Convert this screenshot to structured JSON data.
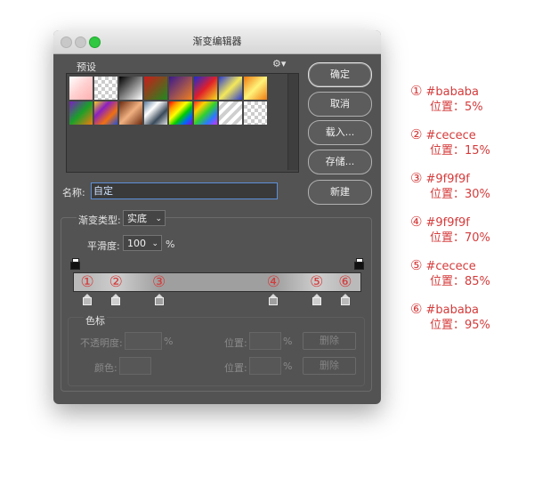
{
  "window": {
    "title": "渐变编辑器"
  },
  "presets": {
    "label": "预设",
    "gear": "gear-icon",
    "swatches_row1": [
      "fg-bg",
      "fg-transparent",
      "black-white",
      "red-green",
      "violet-orange",
      "blue-red-yellow",
      "blue-yellow-blue",
      "orange-yellow-orange"
    ],
    "swatches_row2": [
      "violet-green-orange",
      "yellow-violet-orange-blue",
      "copper",
      "chrome",
      "spectrum",
      "transparent-rainbow",
      "transparent-stripes",
      "transparent"
    ]
  },
  "buttons": {
    "ok": "确定",
    "cancel": "取消",
    "load": "载入...",
    "save": "存储...",
    "new": "新建"
  },
  "name": {
    "label": "名称:",
    "value": "自定"
  },
  "gradient_type": {
    "label": "渐变类型:",
    "value": "实底"
  },
  "smoothness": {
    "label": "平滑度:",
    "value": "100",
    "unit": "%"
  },
  "stops": {
    "numbers": [
      "①",
      "②",
      "③",
      "④",
      "⑤",
      "⑥"
    ],
    "colors": [
      "#bababa",
      "#cecece",
      "#9f9f9f",
      "#9f9f9f",
      "#cecece",
      "#bababa"
    ],
    "locations": [
      5,
      15,
      30,
      70,
      85,
      95
    ]
  },
  "color_stops": {
    "title": "色标",
    "opacity_label": "不透明度:",
    "opacity_unit": "%",
    "location_label": "位置:",
    "location_unit": "%",
    "delete_label": "删除",
    "color_label": "颜色:"
  },
  "annotations": [
    {
      "num": "①",
      "color": "#bababa",
      "pos": "位置：5%"
    },
    {
      "num": "②",
      "color": "#cecece",
      "pos": "位置：15%"
    },
    {
      "num": "③",
      "color": "#9f9f9f",
      "pos": "位置：30%"
    },
    {
      "num": "④",
      "color": "#9f9f9f",
      "pos": "位置：70%"
    },
    {
      "num": "⑤",
      "color": "#cecece",
      "pos": "位置：85%"
    },
    {
      "num": "⑥",
      "color": "#bababa",
      "pos": "位置：95%"
    }
  ]
}
